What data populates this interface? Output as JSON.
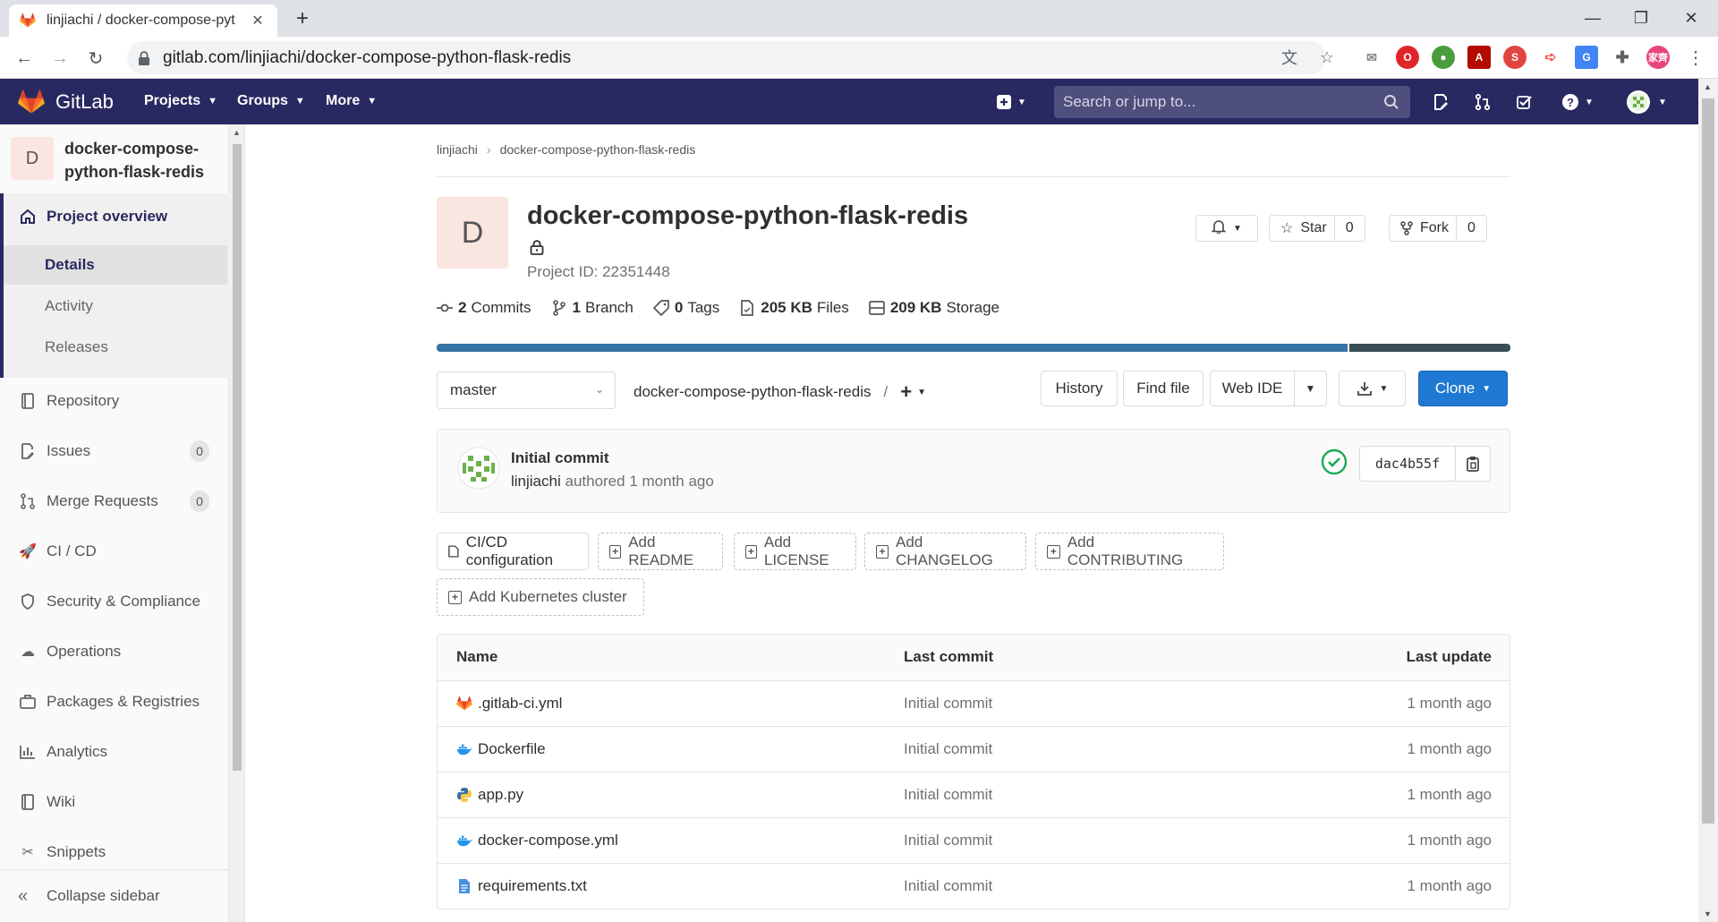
{
  "browser": {
    "tab_title": "linjiachi / docker-compose-pyt",
    "url": "gitlab.com/linjiachi/docker-compose-python-flask-redis",
    "profile_initials": "家齊"
  },
  "header": {
    "brand": "GitLab",
    "nav": [
      "Projects",
      "Groups",
      "More"
    ],
    "search_placeholder": "Search or jump to..."
  },
  "sidebar": {
    "avatar_letter": "D",
    "project_name": "docker-compose-python-flask-redis",
    "overview_label": "Project overview",
    "sub_items": [
      "Details",
      "Activity",
      "Releases"
    ],
    "items": [
      {
        "label": "Repository",
        "icon": "book-icon"
      },
      {
        "label": "Issues",
        "icon": "issues-icon",
        "badge": "0"
      },
      {
        "label": "Merge Requests",
        "icon": "merge-request-icon",
        "badge": "0"
      },
      {
        "label": "CI / CD",
        "icon": "rocket-icon"
      },
      {
        "label": "Security & Compliance",
        "icon": "shield-icon"
      },
      {
        "label": "Operations",
        "icon": "cloud-gear-icon"
      },
      {
        "label": "Packages & Registries",
        "icon": "package-icon"
      },
      {
        "label": "Analytics",
        "icon": "chart-icon"
      },
      {
        "label": "Wiki",
        "icon": "wiki-icon"
      },
      {
        "label": "Snippets",
        "icon": "scissors-icon"
      }
    ],
    "collapse_label": "Collapse sidebar"
  },
  "breadcrumb": [
    "linjiachi",
    "docker-compose-python-flask-redis"
  ],
  "project": {
    "avatar_letter": "D",
    "title": "docker-compose-python-flask-redis",
    "id_label": "Project ID: 22351448",
    "star_label": "Star",
    "star_count": "0",
    "fork_label": "Fork",
    "fork_count": "0"
  },
  "stats": [
    {
      "value": "2",
      "label": "Commits",
      "icon": "commit-icon"
    },
    {
      "value": "1",
      "label": "Branch",
      "icon": "branch-icon"
    },
    {
      "value": "0",
      "label": "Tags",
      "icon": "tag-icon"
    },
    {
      "value": "205 KB",
      "label": "Files",
      "icon": "file-icon"
    },
    {
      "value": "209 KB",
      "label": "Storage",
      "icon": "storage-icon"
    }
  ],
  "languages": [
    {
      "share": 0.85,
      "color": "#3572a5"
    },
    {
      "share": 0.15,
      "color": "#384d54"
    }
  ],
  "repo_toolbar": {
    "branch": "master",
    "path": "docker-compose-python-flask-redis",
    "path_sep": "/",
    "history": "History",
    "find_file": "Find file",
    "web_ide": "Web IDE",
    "clone": "Clone"
  },
  "last_commit": {
    "title": "Initial commit",
    "author": "linjiachi",
    "meta": "authored 1 month ago",
    "sha": "dac4b55f"
  },
  "quick_actions": [
    "CI/CD configuration",
    "Add README",
    "Add LICENSE",
    "Add CHANGELOG",
    "Add CONTRIBUTING",
    "Add Kubernetes cluster"
  ],
  "file_table": {
    "headers": [
      "Name",
      "Last commit",
      "Last update"
    ],
    "rows": [
      {
        "name": ".gitlab-ci.yml",
        "icon": "gitlab-icon",
        "commit": "Initial commit",
        "update": "1 month ago"
      },
      {
        "name": "Dockerfile",
        "icon": "docker-icon",
        "commit": "Initial commit",
        "update": "1 month ago"
      },
      {
        "name": "app.py",
        "icon": "python-icon",
        "commit": "Initial commit",
        "update": "1 month ago"
      },
      {
        "name": "docker-compose.yml",
        "icon": "docker-icon",
        "commit": "Initial commit",
        "update": "1 month ago"
      },
      {
        "name": "requirements.txt",
        "icon": "text-file-icon",
        "commit": "Initial commit",
        "update": "1 month ago"
      }
    ]
  },
  "colors": {
    "header_bg": "#292961",
    "accent_blue": "#1f78d1",
    "success_green": "#1aaa55"
  }
}
